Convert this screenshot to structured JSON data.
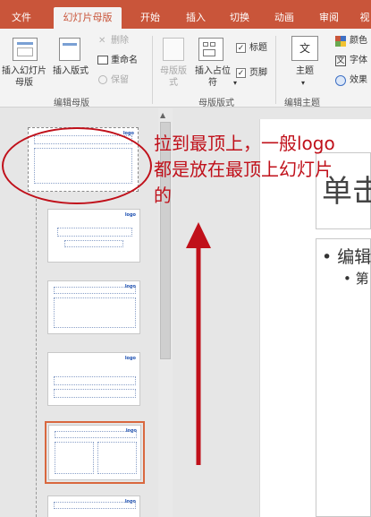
{
  "tabs": [
    "文件",
    "幻灯片母版",
    "开始",
    "插入",
    "切换",
    "动画",
    "审阅",
    "视"
  ],
  "ribbon": {
    "insert_master": "插入幻灯片母版",
    "insert_layout": "插入版式",
    "delete": "删除",
    "rename": "重命名",
    "preserve": "保留",
    "master_layout": "母版版式",
    "insert_placeholder": "插入占位符",
    "insert_placeholder_arrow": "▾",
    "title_check": "标题",
    "footer_check": "页脚",
    "theme": "主题",
    "theme_arrow": "▾",
    "colors": "颜色",
    "fonts": "字体",
    "effects": "效果",
    "group_edit_master": "编辑母版",
    "group_master_layout": "母版版式",
    "group_edit_theme": "编辑主题"
  },
  "thumbnail": {
    "logo": "logo"
  },
  "slide": {
    "title": "单击",
    "bullet1": "• 编辑",
    "bullet2": "• 第"
  },
  "annotation": {
    "text": "拉到最顶上，一般logo都是放在最顶上幻灯片的",
    "color": "#c0101a"
  },
  "colors": {
    "ribbon_accent": "#c9553a",
    "selected_outline": "#d9683f"
  }
}
